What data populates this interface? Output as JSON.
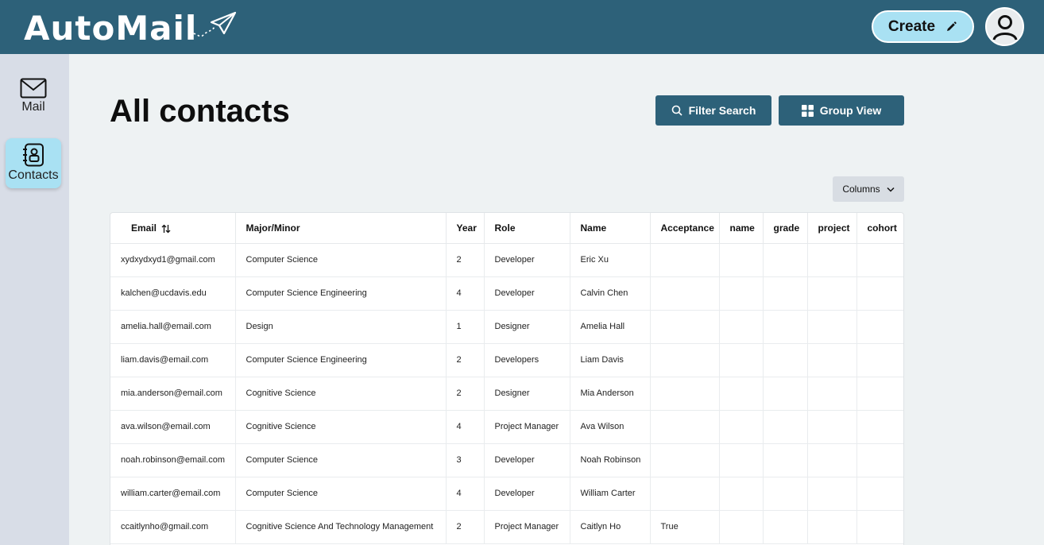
{
  "app": {
    "name": "AutoMail"
  },
  "header": {
    "create_label": "Create"
  },
  "sidebar": {
    "items": [
      {
        "label": "Mail",
        "icon": "mail-icon"
      },
      {
        "label": "Contacts",
        "icon": "contacts-icon"
      }
    ]
  },
  "main": {
    "title": "All contacts",
    "filter_label": "Filter Search",
    "group_label": "Group View",
    "columns_label": "Columns"
  },
  "table": {
    "headers": [
      "Email",
      "Major/Minor",
      "Year",
      "Role",
      "Name",
      "Acceptance",
      "name",
      "grade",
      "project",
      "cohort"
    ],
    "rows": [
      [
        "xydxydxyd1@gmail.com",
        "Computer Science",
        "2",
        "Developer",
        "Eric Xu",
        "",
        "",
        "",
        "",
        ""
      ],
      [
        "kalchen@ucdavis.edu",
        "Computer Science Engineering",
        "4",
        "Developer",
        "Calvin Chen",
        "",
        "",
        "",
        "",
        ""
      ],
      [
        "amelia.hall@email.com",
        "Design",
        "1",
        "Designer",
        "Amelia Hall",
        "",
        "",
        "",
        "",
        ""
      ],
      [
        "liam.davis@email.com",
        "Computer Science Engineering",
        "2",
        "Developers",
        "Liam Davis",
        "",
        "",
        "",
        "",
        ""
      ],
      [
        "mia.anderson@email.com",
        "Cognitive Science",
        "2",
        "Designer",
        "Mia Anderson",
        "",
        "",
        "",
        "",
        ""
      ],
      [
        "ava.wilson@email.com",
        "Cognitive Science",
        "4",
        "Project Manager",
        "Ava Wilson",
        "",
        "",
        "",
        "",
        ""
      ],
      [
        "noah.robinson@email.com",
        "Computer Science",
        "3",
        "Developer",
        "Noah Robinson",
        "",
        "",
        "",
        "",
        ""
      ],
      [
        "william.carter@email.com",
        "Computer Science",
        "4",
        "Developer",
        "William Carter",
        "",
        "",
        "",
        "",
        ""
      ],
      [
        "ccaitlynho@gmail.com",
        "Cognitive Science And Technology Management",
        "2",
        "Project Manager",
        "Caitlyn Ho",
        "True",
        "",
        "",
        "",
        ""
      ]
    ]
  },
  "colors": {
    "header_bg": "#2d6179",
    "accent_light": "#a9e1f3",
    "sidebar_bg": "#d8dde7",
    "page_bg": "#eef2f3"
  }
}
